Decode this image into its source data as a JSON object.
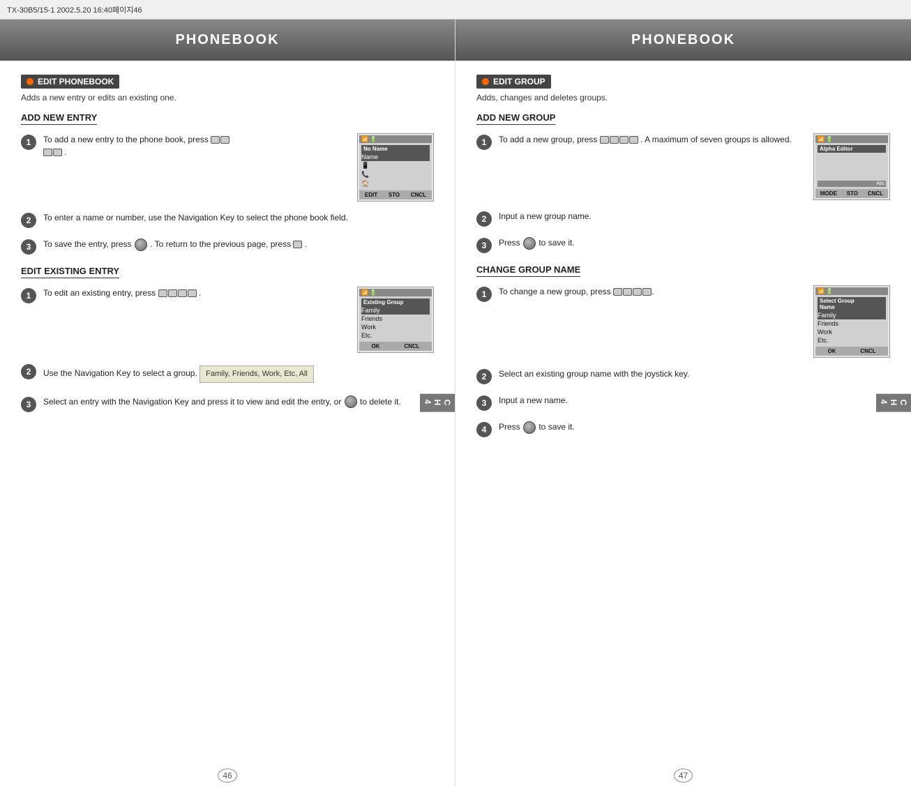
{
  "topbar": {
    "text": "TX-30B5/15-1  2002.5.20  16:40페이지46"
  },
  "left_page": {
    "header": "PHONEBOOK",
    "section_label": "EDIT PHONEBOOK",
    "section_desc": "Adds a new entry or edits an existing one.",
    "subsections": [
      {
        "id": "add_new_entry",
        "title": "ADD NEW ENTRY",
        "steps": [
          {
            "num": "1",
            "text": "To add a new entry to the phone book, press",
            "has_image": true,
            "image_title": "No Name\nName",
            "image_rows": [
              "No Name",
              "Name",
              "",
              ""
            ],
            "image_footer": [
              "EDIT",
              "STO",
              "CNCL"
            ]
          },
          {
            "num": "2",
            "text": "To enter a name or number, use the Navigation Key to select the phone book field.",
            "has_image": false
          },
          {
            "num": "3",
            "text": "To save the entry, press      . To return to the previous page, press      .",
            "has_image": false
          }
        ]
      },
      {
        "id": "edit_existing_entry",
        "title": "EDIT EXISTING ENTRY",
        "steps": [
          {
            "num": "1",
            "text": "To edit an existing entry, press",
            "has_image": true,
            "image_title": "Existing Group",
            "image_rows": [
              "Family",
              "Friends",
              "Work",
              "Etc."
            ],
            "image_footer": [
              "OK",
              "CNCL"
            ]
          },
          {
            "num": "2",
            "text": "Use the Navigation Key to select a group.",
            "has_image": false,
            "family_box": "Family, Friends, Work, Etc, All"
          },
          {
            "num": "3",
            "text": "Select an entry with the Navigation Key and press it to view and edit the entry, or       to delete it.",
            "has_image": false
          }
        ]
      }
    ],
    "page_number": "46",
    "ch_tab": "C\nH\n4"
  },
  "right_page": {
    "header": "PHONEBOOK",
    "section_label": "EDIT GROUP",
    "section_desc": "Adds, changes and deletes groups.",
    "subsections": [
      {
        "id": "add_new_group",
        "title": "ADD NEW GROUP",
        "steps": [
          {
            "num": "1",
            "text": "To add a new group, press          . A maximum of seven groups is allowed.",
            "has_image": true,
            "image_title": "Alpha Editor",
            "image_rows": [
              "",
              "",
              ""
            ],
            "image_footer": [
              "MODE",
              "STO",
              "CNCL"
            ],
            "abc_badge": "Abc"
          },
          {
            "num": "2",
            "text": "Input a new group name.",
            "has_image": false
          },
          {
            "num": "3",
            "text": "Press       to save it.",
            "has_image": false
          }
        ]
      },
      {
        "id": "change_group_name",
        "title": "CHANGE GROUP NAME",
        "steps": [
          {
            "num": "1",
            "text": "To change a new group, press",
            "has_image": true,
            "image_title": "Select Group\nName",
            "image_rows": [
              "Family",
              "Friends",
              "Work",
              "Etc."
            ],
            "image_footer": [
              "OK",
              "CNCL"
            ],
            "selected_row": 0
          },
          {
            "num": "2",
            "text": "Select an existing group name with the joystick key.",
            "has_image": false
          },
          {
            "num": "3",
            "text": "Input a new name.",
            "has_image": false
          },
          {
            "num": "4",
            "text": "Press       to save it.",
            "has_image": false
          }
        ]
      }
    ],
    "page_number": "47",
    "ch_tab": "C\nH\n4"
  }
}
